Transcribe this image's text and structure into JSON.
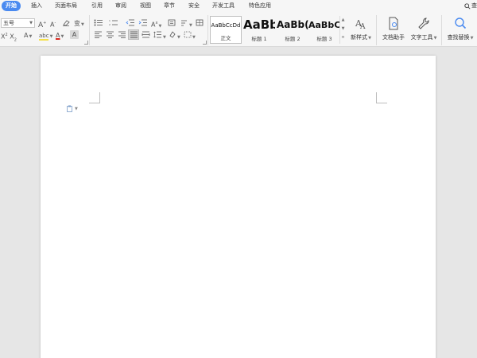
{
  "menu": {
    "tabs": [
      {
        "label": "开始",
        "active": true
      },
      {
        "label": "插入"
      },
      {
        "label": "页面布局"
      },
      {
        "label": "引用"
      },
      {
        "label": "审阅"
      },
      {
        "label": "视图"
      },
      {
        "label": "章节"
      },
      {
        "label": "安全"
      },
      {
        "label": "开发工具"
      },
      {
        "label": "特色应用"
      }
    ],
    "search_label": "查"
  },
  "ribbon": {
    "font_size": "五号",
    "styles": [
      {
        "sample": "AaBbCcDd",
        "name": "正文",
        "selected": true
      },
      {
        "sample": "AaBb",
        "name": "标题 1"
      },
      {
        "sample": "AaBb(",
        "name": "标题 2"
      },
      {
        "sample": "AaBbC",
        "name": "标题 3"
      }
    ],
    "new_style_label": "新样式",
    "doc_helper_label": "文档助手",
    "text_tools_label": "文字工具",
    "find_replace_label": "查找替换"
  },
  "colors": {
    "accent": "#4a8af0",
    "font_color": "#d9261c",
    "highlight": "#f5e04a"
  }
}
